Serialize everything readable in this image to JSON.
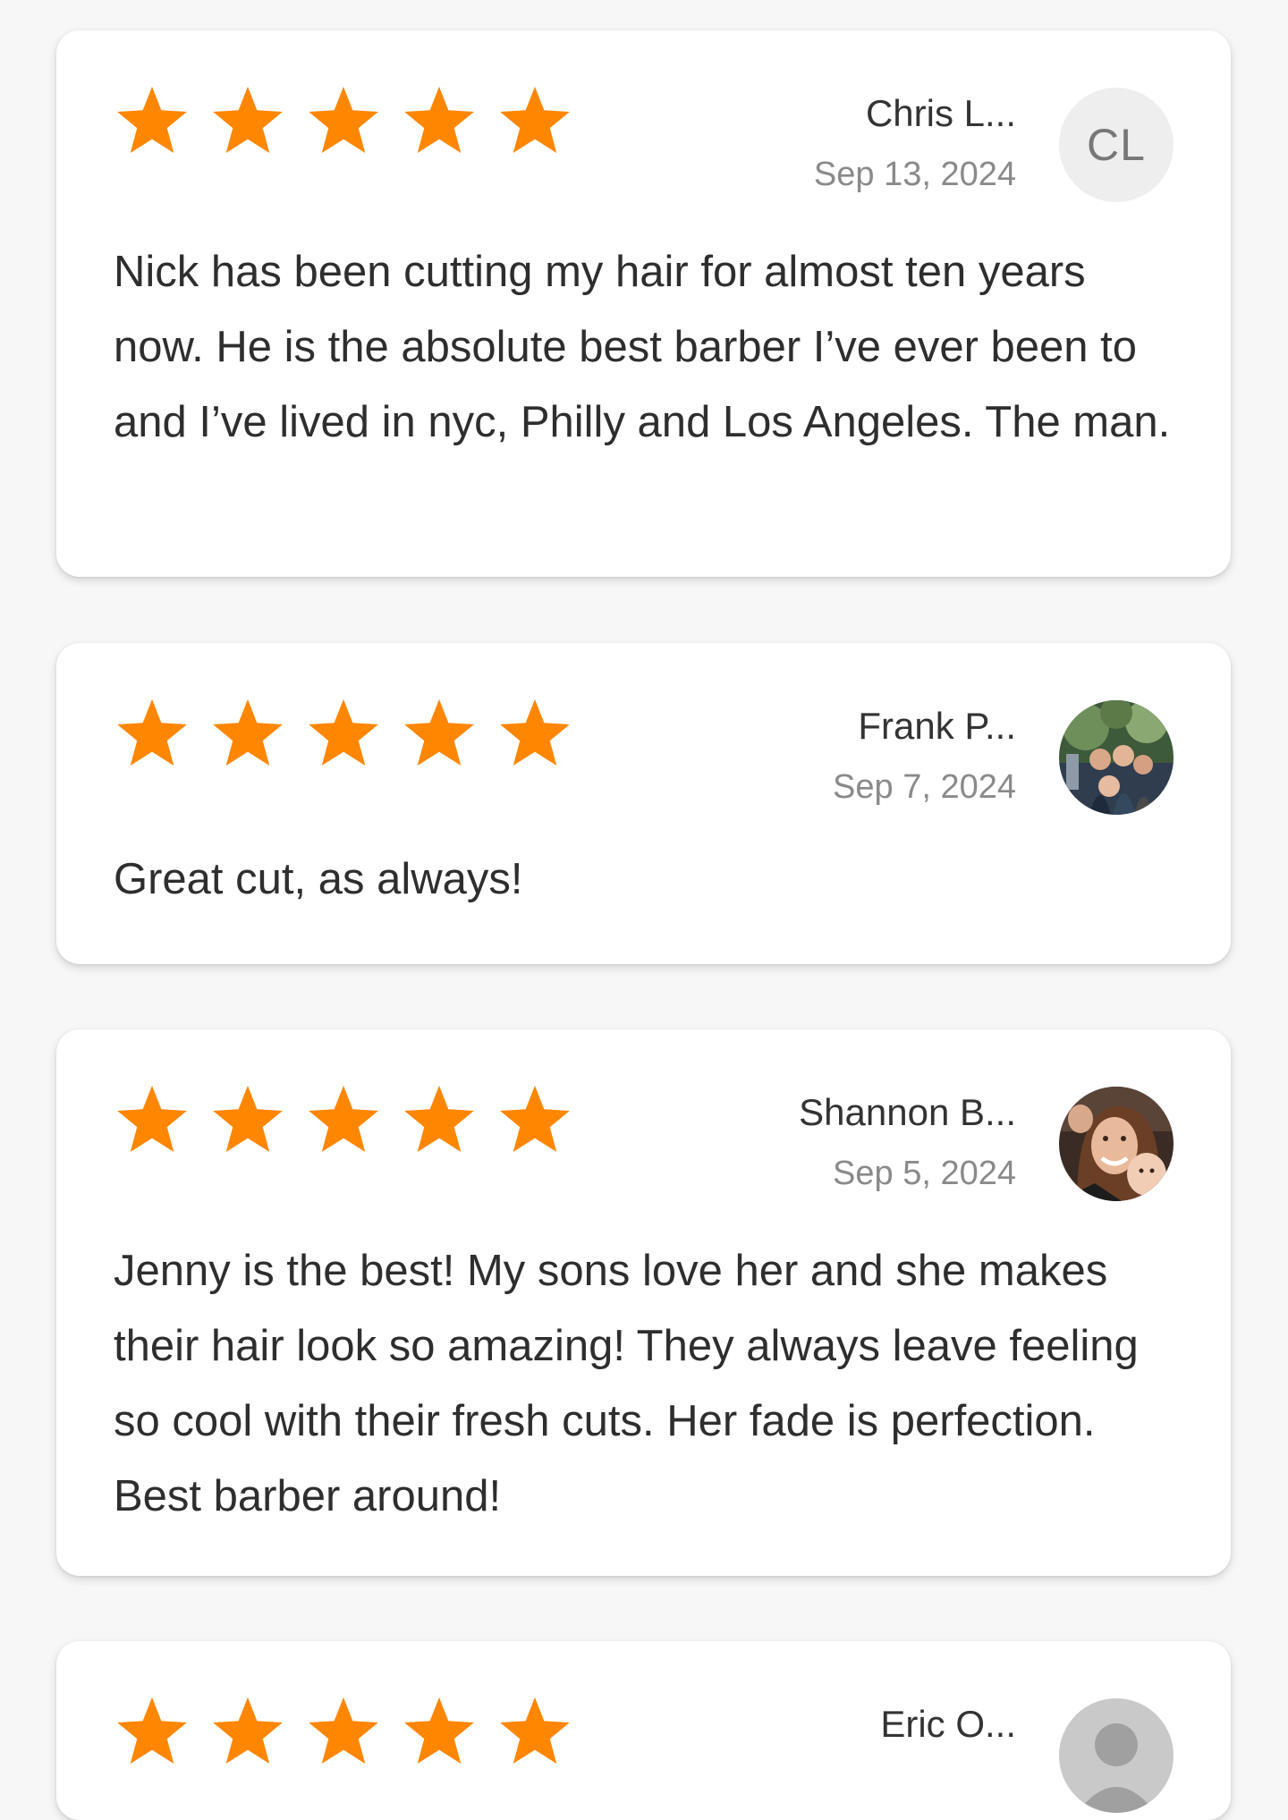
{
  "colors": {
    "star": "#ff8600",
    "background": "#f7f7f7",
    "card": "#ffffff"
  },
  "reviews": [
    {
      "rating": 5,
      "author": "Chris L...",
      "date": "Sep 13, 2024",
      "avatar_initials": "CL",
      "text": "Nick has been cutting my hair for almost ten years now. He is the absolute best barber I’ve ever been to and I’ve lived in nyc, Philly and Los Angeles. The man."
    },
    {
      "rating": 5,
      "author": "Frank P...",
      "date": "Sep 7, 2024",
      "avatar_icon": "user-photo-icon",
      "text": "Great cut, as always!"
    },
    {
      "rating": 5,
      "author": "Shannon B...",
      "date": "Sep 5, 2024",
      "avatar_icon": "user-photo-icon",
      "text": "Jenny is the best! My sons love her and she makes their hair look so amazing! They always leave feeling so cool with their fresh cuts. Her fade is perfection. Best barber around!"
    },
    {
      "rating": 5,
      "author": "Eric O...",
      "avatar_icon": "user-photo-icon"
    }
  ]
}
